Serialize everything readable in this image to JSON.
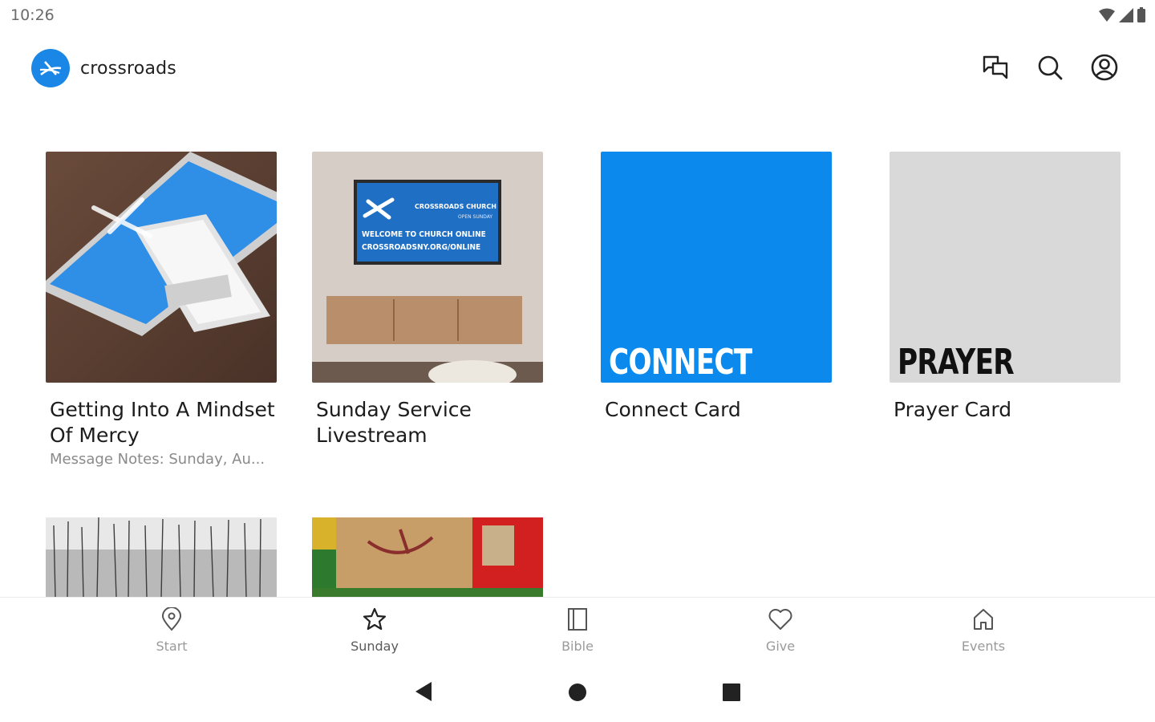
{
  "status_bar": {
    "time": "10:26"
  },
  "header": {
    "brand": "crossroads"
  },
  "cards": [
    {
      "title": "Getting Into A Mindset Of Mercy",
      "subtitle": "Message Notes: Sunday, Au..."
    },
    {
      "title": "Sunday Service Livestream",
      "tv_brand": "CROSSROADS CHURCH",
      "tv_tagline": "OPEN SUNDAY",
      "tv_line1": "WELCOME TO CHURCH ONLINE",
      "tv_line2": "CROSSROADSNY.ORG/ONLINE"
    },
    {
      "title": "Connect Card",
      "cover_word": "CONNECT",
      "cover_color": "#0c89ec"
    },
    {
      "title": "Prayer Card",
      "cover_word": "PRAYER",
      "cover_color": "#d9d9d9"
    }
  ],
  "bottom_nav": [
    {
      "label": "Start",
      "icon": "map-pin-icon"
    },
    {
      "label": "Sunday",
      "icon": "star-icon",
      "active": true
    },
    {
      "label": "Bible",
      "icon": "book-icon"
    },
    {
      "label": "Give",
      "icon": "heart-icon"
    },
    {
      "label": "Events",
      "icon": "home-icon"
    }
  ],
  "colors": {
    "brand": "#1a87e6",
    "connect": "#0c89ec",
    "prayer": "#d9d9d9"
  }
}
